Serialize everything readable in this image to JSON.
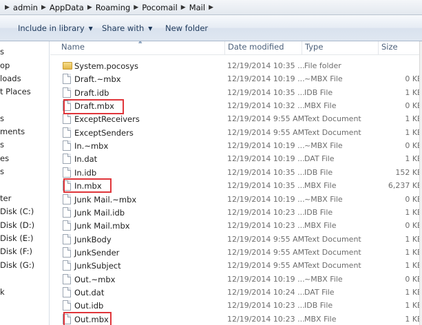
{
  "breadcrumb": [
    "admin",
    "AppData",
    "Roaming",
    "Pocomail",
    "Mail"
  ],
  "toolbar": {
    "include_in_library": "Include in library",
    "share_with": "Share with",
    "new_folder": "New folder"
  },
  "nav": {
    "items": [
      "s",
      "op",
      "loads",
      "t Places",
      "s",
      "ments",
      "s",
      "es",
      "s",
      "ter",
      "Disk (C:)",
      "Disk (D:)",
      "Disk (E:)",
      "Disk (F:)",
      "Disk (G:)",
      "k"
    ]
  },
  "columns": {
    "name": "Name",
    "date": "Date modified",
    "type": "Type",
    "size": "Size"
  },
  "files": [
    {
      "name": "System.pocosys",
      "date": "12/19/2014 10:35 ...",
      "type": "File folder",
      "size": "",
      "icon": "folder-icon"
    },
    {
      "name": "Draft.~mbx",
      "date": "12/19/2014 10:19 ...",
      "type": "~MBX File",
      "size": "0 KE",
      "icon": "file-icon"
    },
    {
      "name": "Draft.idb",
      "date": "12/19/2014 10:35 ...",
      "type": "IDB File",
      "size": "1 KE",
      "icon": "file-icon"
    },
    {
      "name": "Draft.mbx",
      "date": "12/19/2014 10:32 ...",
      "type": "MBX File",
      "size": "0 KE",
      "icon": "file-icon"
    },
    {
      "name": "ExceptReceivers",
      "date": "12/19/2014 9:55 AM",
      "type": "Text Document",
      "size": "1 KE",
      "icon": "file-icon"
    },
    {
      "name": "ExceptSenders",
      "date": "12/19/2014 9:55 AM",
      "type": "Text Document",
      "size": "1 KE",
      "icon": "file-icon"
    },
    {
      "name": "In.~mbx",
      "date": "12/19/2014 10:19 ...",
      "type": "~MBX File",
      "size": "0 KE",
      "icon": "file-icon"
    },
    {
      "name": "In.dat",
      "date": "12/19/2014 10:19 ...",
      "type": "DAT File",
      "size": "1 KE",
      "icon": "file-icon"
    },
    {
      "name": "In.idb",
      "date": "12/19/2014 10:35 ...",
      "type": "IDB File",
      "size": "152 KE",
      "icon": "file-icon"
    },
    {
      "name": "In.mbx",
      "date": "12/19/2014 10:35 ...",
      "type": "MBX File",
      "size": "6,237 KE",
      "icon": "file-icon"
    },
    {
      "name": "Junk Mail.~mbx",
      "date": "12/19/2014 10:19 ...",
      "type": "~MBX File",
      "size": "0 KE",
      "icon": "file-icon"
    },
    {
      "name": "Junk Mail.idb",
      "date": "12/19/2014 10:23 ...",
      "type": "IDB File",
      "size": "1 KE",
      "icon": "file-icon"
    },
    {
      "name": "Junk Mail.mbx",
      "date": "12/19/2014 10:23 ...",
      "type": "MBX File",
      "size": "0 KE",
      "icon": "file-icon"
    },
    {
      "name": "JunkBody",
      "date": "12/19/2014 9:55 AM",
      "type": "Text Document",
      "size": "1 KE",
      "icon": "file-icon"
    },
    {
      "name": "JunkSender",
      "date": "12/19/2014 9:55 AM",
      "type": "Text Document",
      "size": "1 KE",
      "icon": "file-icon"
    },
    {
      "name": "JunkSubject",
      "date": "12/19/2014 9:55 AM",
      "type": "Text Document",
      "size": "1 KE",
      "icon": "file-icon"
    },
    {
      "name": "Out.~mbx",
      "date": "12/19/2014 10:19 ...",
      "type": "~MBX File",
      "size": "0 KE",
      "icon": "file-icon"
    },
    {
      "name": "Out.dat",
      "date": "12/19/2014 10:24 ...",
      "type": "DAT File",
      "size": "1 KE",
      "icon": "file-icon"
    },
    {
      "name": "Out.idb",
      "date": "12/19/2014 10:23 ...",
      "type": "IDB File",
      "size": "1 KE",
      "icon": "file-icon"
    },
    {
      "name": "Out.mbx",
      "date": "12/19/2014 10:23 ...",
      "type": "MBX File",
      "size": "1 KE",
      "icon": "file-icon"
    }
  ],
  "colors": {
    "highlight": "#e0353a",
    "toolbar_text": "#1e395b",
    "header_text": "#4c607a"
  }
}
